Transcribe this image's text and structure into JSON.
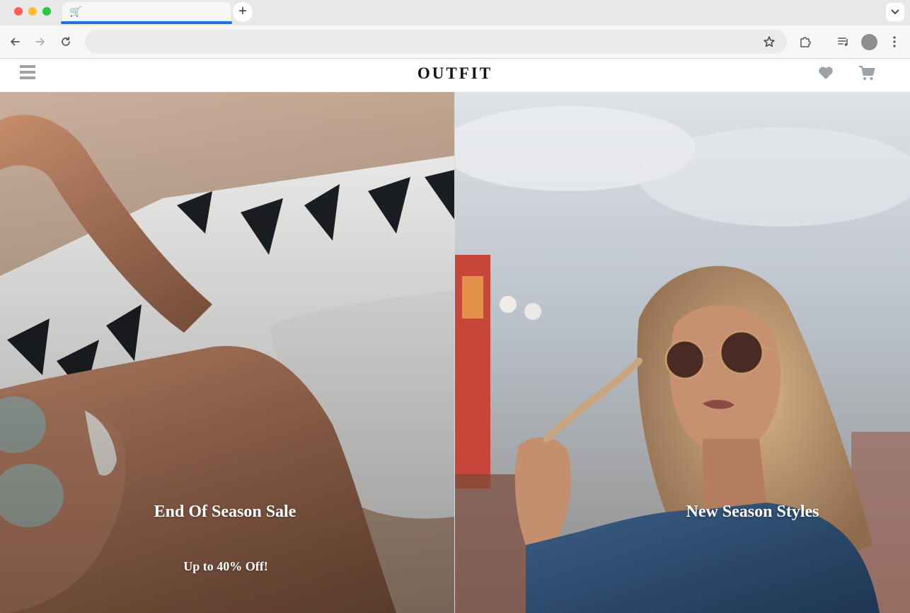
{
  "browser": {
    "tab": {
      "favicon": "🛒",
      "title": ""
    },
    "new_tab_label": "+",
    "address_bar": {
      "value": "",
      "placeholder": ""
    }
  },
  "site": {
    "logo": "OUTFIT",
    "icons": {
      "menu": "hamburger-menu-icon",
      "wishlist": "heart-icon",
      "cart": "shopping-cart-icon"
    }
  },
  "hero": {
    "left": {
      "title": "End Of Season Sale",
      "subtitle": "Up to 40% Off!"
    },
    "right": {
      "title": "New Season Styles"
    }
  },
  "colors": {
    "accent_tab": "#1a73e8",
    "header_icons": "#9da3a6",
    "hero_text": "#ffffff"
  }
}
